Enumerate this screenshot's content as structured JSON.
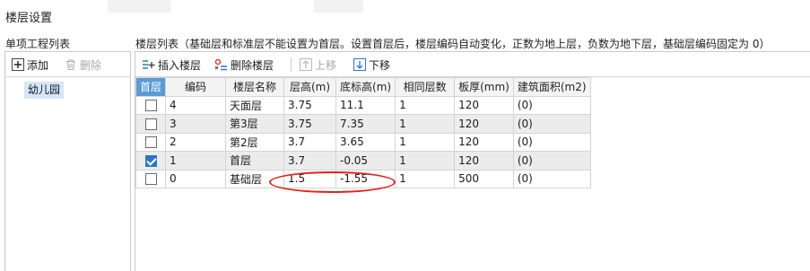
{
  "window": {
    "title": "楼层设置"
  },
  "left": {
    "label": "单项工程列表",
    "toolbar": {
      "add_label": "添加",
      "delete_label": "删除"
    },
    "items": [
      {
        "label": "幼儿园",
        "selected": true
      }
    ]
  },
  "right": {
    "label": "楼层列表（基础层和标准层不能设置为首层。设置首层后，楼层编码自动变化，正数为地上层，负数为地下层，基础层编码固定为 0）",
    "toolbar": {
      "insert_label": "插入楼层",
      "delete_label": "删除楼层",
      "up_label": "上移",
      "down_label": "下移"
    },
    "columns": [
      "首层",
      "编码",
      "楼层名称",
      "层高(m)",
      "底标高(m)",
      "相同层数",
      "板厚(mm)",
      "建筑面积(m2)"
    ],
    "rows": [
      {
        "first": false,
        "code": "4",
        "name": "天面层",
        "height": "3.75",
        "bottom": "11.1",
        "same": "1",
        "thickness": "120",
        "area": "(0)"
      },
      {
        "first": false,
        "code": "3",
        "name": "第3层",
        "height": "3.75",
        "bottom": "7.35",
        "same": "1",
        "thickness": "120",
        "area": "(0)"
      },
      {
        "first": false,
        "code": "2",
        "name": "第2层",
        "height": "3.7",
        "bottom": "3.65",
        "same": "1",
        "thickness": "120",
        "area": "(0)"
      },
      {
        "first": true,
        "code": "1",
        "name": "首层",
        "height": "3.7",
        "bottom": "-0.05",
        "same": "1",
        "thickness": "120",
        "area": "(0)"
      },
      {
        "first": false,
        "code": "0",
        "name": "基础层",
        "height": "1.5",
        "bottom": "-1.55",
        "same": "1",
        "thickness": "500",
        "area": "(0)"
      }
    ]
  },
  "colors": {
    "accent": "#5b9bd5",
    "checked": "#2b78c5",
    "annotation": "#e2231a",
    "selection": "#d5e6f8"
  }
}
